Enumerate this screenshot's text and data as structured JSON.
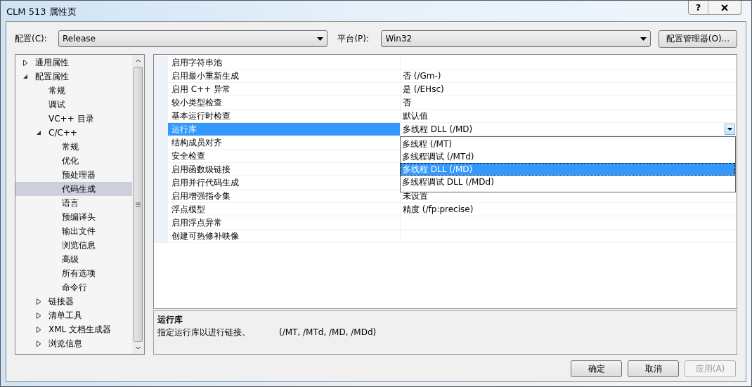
{
  "window": {
    "title": "CLM 513 属性页",
    "help_button": "?"
  },
  "configuration": {
    "label": "配置(C):",
    "value": "Release"
  },
  "platform": {
    "label": "平台(P):",
    "value": "Win32"
  },
  "config_manager_button": "配置管理器(O)...",
  "tree": [
    {
      "label": "通用属性",
      "expanded": false,
      "selected": false
    },
    {
      "label": "配置属性",
      "expanded": true,
      "selected": false,
      "children": [
        {
          "label": "常规",
          "selected": false
        },
        {
          "label": "调试",
          "selected": false
        },
        {
          "label": "VC++ 目录",
          "selected": false
        },
        {
          "label": "C/C++",
          "expanded": true,
          "selected": false,
          "children": [
            {
              "label": "常规",
              "selected": false
            },
            {
              "label": "优化",
              "selected": false
            },
            {
              "label": "预处理器",
              "selected": false
            },
            {
              "label": "代码生成",
              "selected": true
            },
            {
              "label": "语言",
              "selected": false
            },
            {
              "label": "预编译头",
              "selected": false
            },
            {
              "label": "输出文件",
              "selected": false
            },
            {
              "label": "浏览信息",
              "selected": false
            },
            {
              "label": "高级",
              "selected": false
            },
            {
              "label": "所有选项",
              "selected": false
            },
            {
              "label": "命令行",
              "selected": false
            }
          ]
        },
        {
          "label": "链接器",
          "expanded": false,
          "selected": false
        },
        {
          "label": "清单工具",
          "expanded": false,
          "selected": false
        },
        {
          "label": "XML 文档生成器",
          "expanded": false,
          "selected": false
        },
        {
          "label": "浏览信息",
          "expanded": false,
          "selected": false
        }
      ]
    }
  ],
  "properties": [
    {
      "name": "启用字符串池",
      "selected": false
    },
    {
      "name": "启用最小重新生成",
      "value": "否 (/Gm-)",
      "selected": false
    },
    {
      "name": "启用 C++ 异常",
      "value": "是 (/EHsc)",
      "selected": false
    },
    {
      "name": "较小类型检查",
      "value": "否",
      "selected": false
    },
    {
      "name": "基本运行时检查",
      "value": "默认值",
      "selected": false
    },
    {
      "name": "运行库",
      "value": "多线程 DLL (/MD)",
      "selected": true
    },
    {
      "name": "结构成员对齐",
      "selected": false
    },
    {
      "name": "安全检查",
      "selected": false
    },
    {
      "name": "启用函数级链接",
      "selected": false
    },
    {
      "name": "启用并行代码生成",
      "selected": false
    },
    {
      "name": "启用增强指令集",
      "value": "未设置",
      "selected": false
    },
    {
      "name": "浮点模型",
      "value": "精度 (/fp:precise)",
      "selected": false
    },
    {
      "name": "启用浮点异常",
      "selected": false
    },
    {
      "name": "创建可热修补映像",
      "selected": false
    }
  ],
  "dropdown_options": [
    {
      "label": "多线程 (/MT)",
      "selected": false
    },
    {
      "label": "多线程调试 (/MTd)",
      "selected": false
    },
    {
      "label": "多线程 DLL (/MD)",
      "selected": true
    },
    {
      "label": "多线程调试 DLL (/MDd)",
      "selected": false
    }
  ],
  "description": {
    "title": "运行库",
    "text": "指定运行库以进行链接。",
    "switches": "(/MT, /MTd, /MD, /MDd)"
  },
  "buttons": [
    {
      "label": "确定",
      "disabled": false
    },
    {
      "label": "取消",
      "disabled": false
    },
    {
      "label": "应用(A)",
      "disabled": true
    }
  ]
}
